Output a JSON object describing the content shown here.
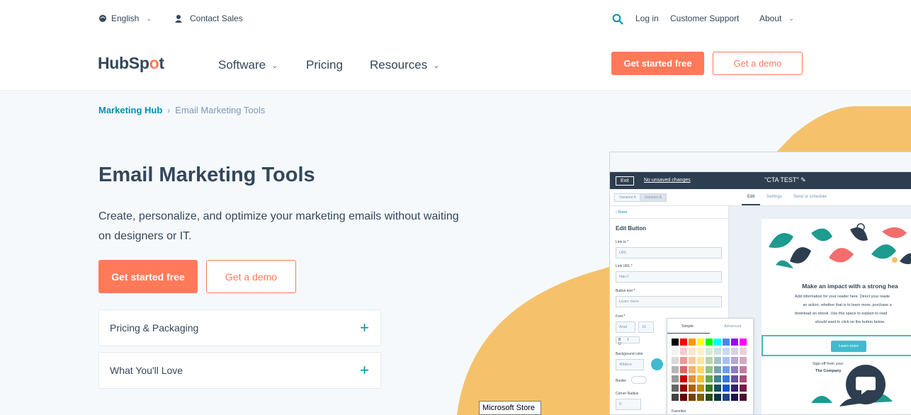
{
  "utility": {
    "language": "English",
    "contact_sales": "Contact Sales",
    "login": "Log in",
    "customer_support": "Customer Support",
    "about": "About"
  },
  "nav": {
    "logo_pre": "HubSp",
    "logo_o": "o",
    "logo_post": "t",
    "software": "Software",
    "pricing": "Pricing",
    "resources": "Resources",
    "cta_primary": "Get started free",
    "cta_secondary": "Get a demo"
  },
  "breadcrumb": {
    "parent": "Marketing Hub",
    "current": "Email Marketing Tools"
  },
  "hero": {
    "title": "Email Marketing Tools",
    "subtitle": "Create, personalize, and optimize your marketing emails without waiting on designers or IT.",
    "cta_primary": "Get started free",
    "cta_secondary": "Get a demo"
  },
  "accordion": [
    {
      "label": "Pricing & Packaging"
    },
    {
      "label": "What You'll Love"
    }
  ],
  "screenshot": {
    "exit": "Exit",
    "unsaved": "No unsaved changes",
    "doc_title": "\"CTA TEST\" ✎",
    "variation_a": "Variation A",
    "variation_b": "Variation B",
    "tab_edit": "Edit",
    "tab_settings": "Settings",
    "tab_send": "Send or schedule",
    "done": "‹ Done",
    "panel_title": "Edit Button",
    "link_to": "Link to *",
    "link_to_value": "URL",
    "link_url": "Link URL *",
    "link_url_value": "http://",
    "button_text": "Button text *",
    "button_text_value": "Learn more",
    "font": "Font *",
    "font_value": "Arial",
    "font_size": "16",
    "bg_color": "Background color",
    "bg_hex": "40bbce",
    "border": "Border",
    "corner_radius": "Corner Radius",
    "corner_value": "8",
    "picker_simple": "Simple",
    "picker_advanced": "Advanced",
    "favorites": "Favorites",
    "email_heading": "Make an impact with a strong hea",
    "email_body_1": "Add information for your reader here. Direct your reade",
    "email_body_2": "an action, whether that is to learn more, purchase a",
    "email_body_3": "download an ebook. Use this space to explain to read",
    "email_body_4": "should want to click on the button below.",
    "email_button": "Learn more",
    "sign_off": "Sign off from your",
    "company": "The Company"
  },
  "colors": {
    "accent": "#ff7a59",
    "link": "#0091ae",
    "text": "#33475b",
    "blob": "#f5c26b",
    "teal": "#40bbce"
  },
  "tooltip": "Microsoft Store"
}
